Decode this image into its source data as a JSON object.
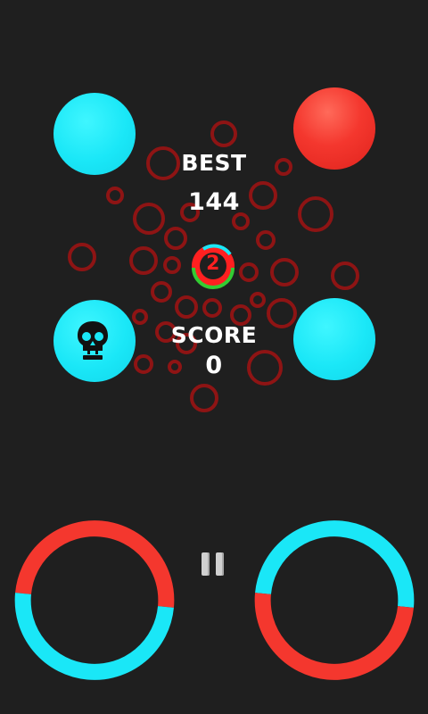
{
  "hud": {
    "best_label": "BEST",
    "best_value": "144",
    "score_label": "SCORE",
    "score_value": "0",
    "lives": "2"
  },
  "colors": {
    "background": "#1f1f1f",
    "cyan": "#1ae7f7",
    "red": "#f4372e",
    "bubble_stroke": "#8e1414",
    "center_green": "#33cc33"
  },
  "balls": [
    {
      "name": "ball-top-left",
      "color": "cyan"
    },
    {
      "name": "ball-top-right",
      "color": "red"
    },
    {
      "name": "ball-mid-left",
      "color": "cyan",
      "icon": "skull-icon"
    },
    {
      "name": "ball-mid-right",
      "color": "cyan"
    }
  ],
  "controls": {
    "pause_icon": "pause-icon",
    "left_ring": {
      "top_color": "red",
      "bottom_color": "cyan"
    },
    "right_ring": {
      "top_color": "cyan",
      "bottom_color": "red"
    }
  }
}
